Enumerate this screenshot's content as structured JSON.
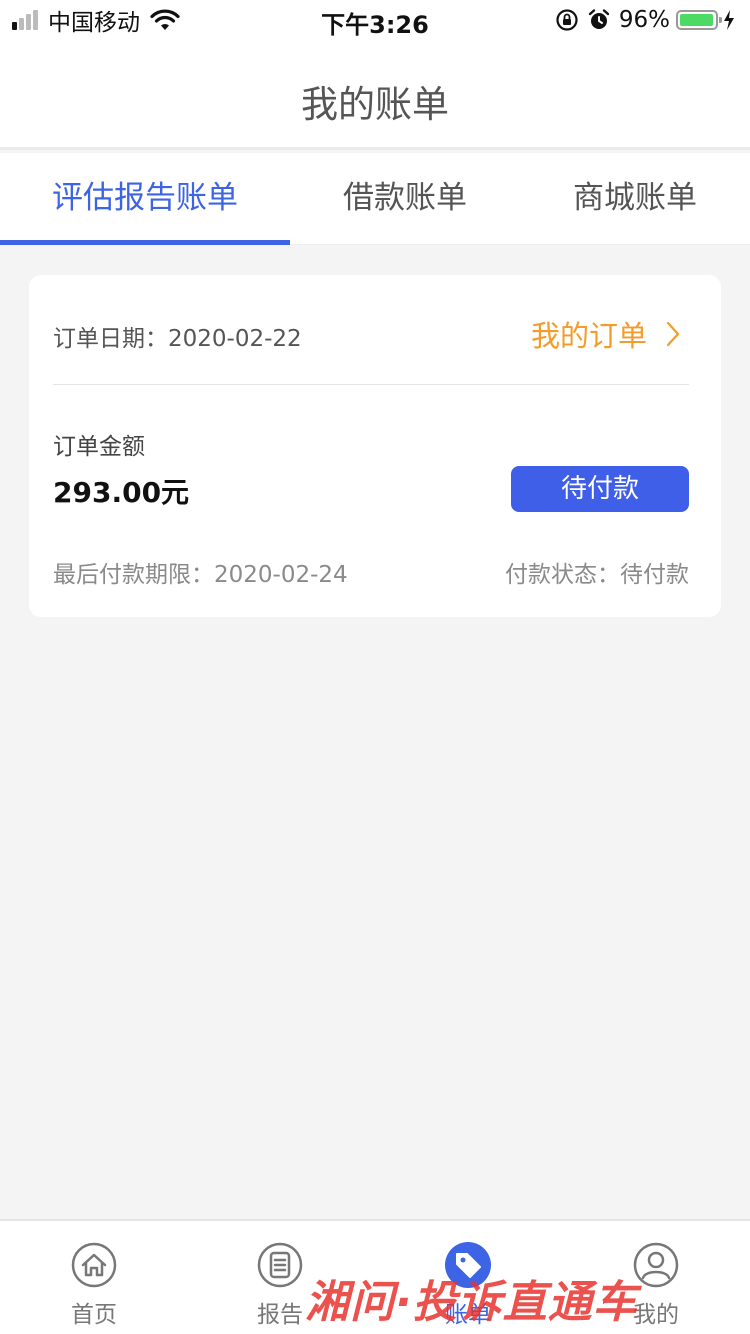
{
  "status_bar": {
    "carrier": "中国移动",
    "time": "下午3:26",
    "battery": "96%",
    "battery_level": 0.96
  },
  "header": {
    "title": "我的账单"
  },
  "tabs": [
    {
      "label": "评估报告账单",
      "active": true
    },
    {
      "label": "借款账单",
      "active": false
    },
    {
      "label": "商城账单",
      "active": false
    }
  ],
  "bill": {
    "order_date": "订单日期：2020-02-22",
    "my_order_link": "我的订单",
    "amount_label": "订单金额",
    "amount": "293.00元",
    "pay_button": "待付款",
    "deadline": "最后付款期限：2020-02-24",
    "status": "付款状态：待付款"
  },
  "tab_bar": [
    {
      "label": "首页",
      "icon": "home-icon",
      "active": false
    },
    {
      "label": "报告",
      "icon": "document-icon",
      "active": false
    },
    {
      "label": "账单",
      "icon": "tag-icon",
      "active": true
    },
    {
      "label": "我的",
      "icon": "person-icon",
      "active": false
    }
  ],
  "watermark": "湘问·投诉直通车",
  "colors": {
    "accent": "#3c64e4",
    "button": "#3f5fe8",
    "link_orange": "#f39c2c",
    "background": "#f4f4f4"
  }
}
